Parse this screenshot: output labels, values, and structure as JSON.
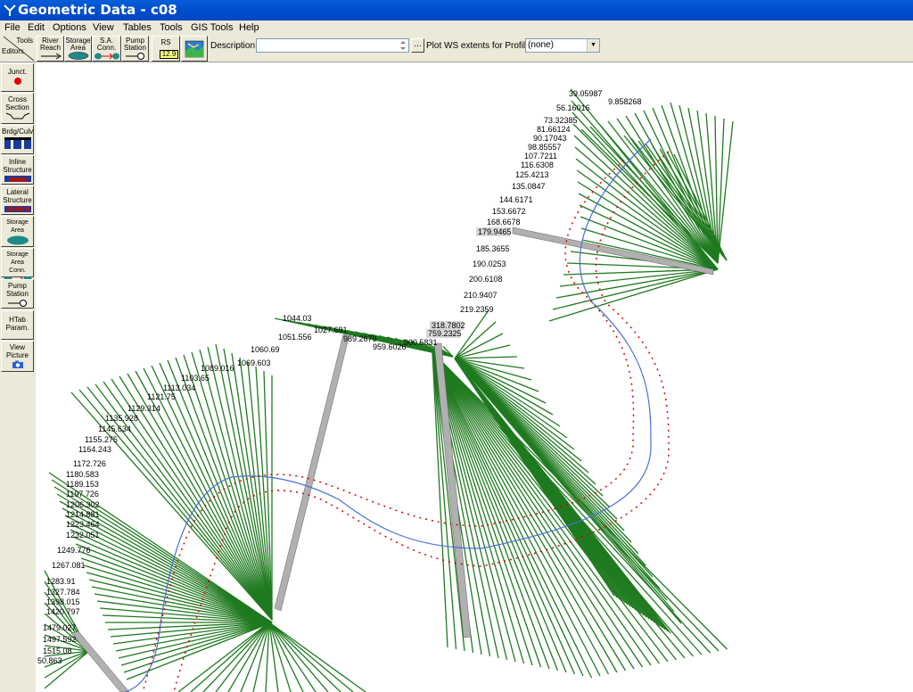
{
  "window": {
    "title": "Geometric Data - c08"
  },
  "menubar": [
    "File",
    "Edit",
    "Options",
    "View",
    "Tables",
    "Tools",
    "GIS Tools",
    "Help"
  ],
  "toolbar": {
    "tools_label": "Tools",
    "editors_label": "Editors",
    "river_reach": "River Reach",
    "storage_area": "Storage Area",
    "sa_conn": "S.A. Conn.",
    "pump_station": "Pump Station",
    "rs_label": "RS",
    "rs_value": "12.9",
    "description_label": "Description :",
    "description_value": "",
    "ellipsis": "...",
    "plot_ws_label": "Plot WS extents for Profile:",
    "profile_value": "(none)"
  },
  "sidebar": {
    "junct": "Junct.",
    "cross_section": "Cross Section",
    "brdg_culv": "Brdg/Culv",
    "inline_structure": "Inline Structure",
    "lateral_structure": "Lateral Structure",
    "storage_area": "Storage Area",
    "storage_area_conn": "Storage Area Conn.",
    "pump_station": "Pump Station",
    "htab_param": "HTab Param.",
    "view_picture": "View Picture"
  },
  "colors": {
    "xs_line": "#1f7a1f",
    "bank": "#e00000",
    "centerline": "#4a6fd8",
    "structure": "#b0b0b0"
  },
  "stations": {
    "upper": [
      "39.05987",
      "9.858268",
      "56.16016",
      "73.32385",
      "81.66124",
      "90.17043",
      "98.85557",
      "107.7211",
      "116.6308",
      "125.4213",
      "135.0847",
      "144.6171",
      "153.6672",
      "168.6678",
      "179.9465",
      "185.3655",
      "190.0253",
      "200.6108",
      "210.9407",
      "219.2359"
    ],
    "middle": [
      "318.7802",
      "759.2325",
      "900.5831",
      "959.6026",
      "989.2679",
      "1027.691",
      "1044.03",
      "1051.556",
      "1060.69",
      "1069.603",
      "1089.016",
      "1103.65",
      "1113.034",
      "1121.75",
      "1129.314",
      "1135.928",
      "1145.634",
      "1155.275",
      "1164.243",
      "1172.726"
    ],
    "lower": [
      "1180.583",
      "1189.153",
      "1197.726",
      "1206.302",
      "1214.881",
      "1223.464",
      "1232.051",
      "1249.776",
      "1267.081",
      "1283.91",
      "1327.784",
      "1398.015",
      "1420.797",
      "1479.027",
      "1497.592",
      "1515.08",
      "50.863"
    ]
  }
}
